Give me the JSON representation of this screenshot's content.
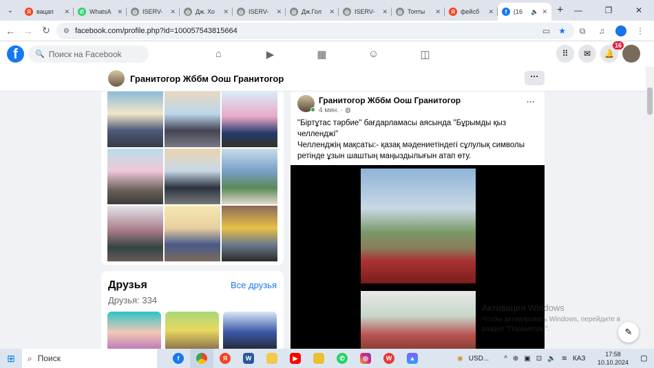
{
  "browser": {
    "tabs": [
      {
        "label": "вацап",
        "favicon_color": "#fc3f1d",
        "favicon": "Я"
      },
      {
        "label": "WhatsA",
        "favicon_color": "#25d366",
        "favicon": "✆"
      },
      {
        "label": "ISERV-",
        "favicon_color": "#8a8a8a",
        "favicon": "◎"
      },
      {
        "label": "Дж. Хо",
        "favicon_color": "#8a8a8a",
        "favicon": "◎"
      },
      {
        "label": "ISERV-",
        "favicon_color": "#8a8a8a",
        "favicon": "◎"
      },
      {
        "label": "Дж.Гол",
        "favicon_color": "#8a8a8a",
        "favicon": "◎"
      },
      {
        "label": "ISERV-",
        "favicon_color": "#8a8a8a",
        "favicon": "◎"
      },
      {
        "label": "Топты",
        "favicon_color": "#8a8a8a",
        "favicon": "◎"
      },
      {
        "label": "фейсб",
        "favicon_color": "#fc3f1d",
        "favicon": "Я"
      }
    ],
    "active_tab": {
      "label": "(16",
      "favicon_color": "#1877f2",
      "favicon": "f"
    },
    "new_tab": "+",
    "url": "facebook.com/profile.php?id=100057543815664"
  },
  "facebook": {
    "search_placeholder": "Поиск на Facebook",
    "notification_count": "16",
    "brand_color": "#1877f2"
  },
  "profile_bar": {
    "name": "Гранитогор Жббм Оош Гранитогор",
    "more": "···"
  },
  "friends": {
    "title": "Друзья",
    "all_link": "Все друзья",
    "count": "Друзья: 334"
  },
  "post": {
    "author": "Гранитогор Жббм Оош Гранитогор",
    "time": "4 мин. ·",
    "line1": "\"Біртұтас тәрбие\" бағдарламасы аясында \"Бұрымды қыз челленджі\"",
    "line2": "Челленджің мақсаты:- қазақ мәдениетіндегі сұлулық символы ретінде ұзын шаштың маңыздылығын атап өту."
  },
  "watermark": {
    "title": "Активация Windows",
    "text": "Чтобы активировать Windows, перейдите в раздел \"Параметры\"."
  },
  "taskbar": {
    "search": "Поиск",
    "currency": "USD...",
    "lang": "КАЗ",
    "time": "17:58",
    "date": "10.10.2024"
  }
}
